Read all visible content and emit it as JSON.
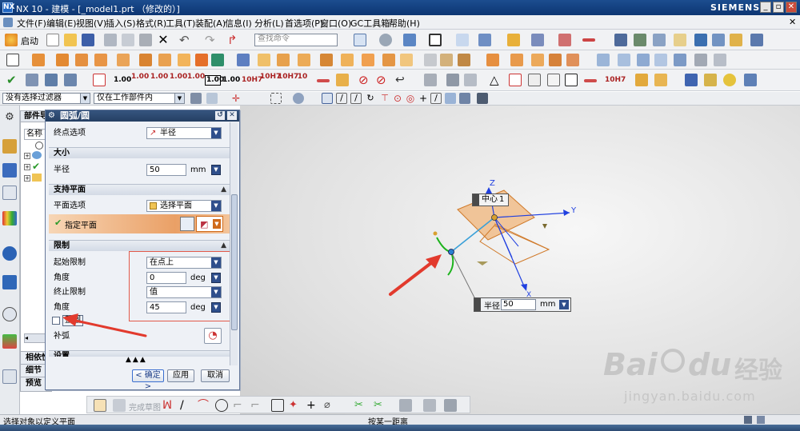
{
  "window": {
    "logo": "NX",
    "title": "NX 10 - 建模 - [_model1.prt （修改的）]",
    "brand": "SIEMENS",
    "min_glyph": "_",
    "restore_glyph": "▫",
    "close_glyph": "✕"
  },
  "menu": {
    "items": [
      "文件(F)",
      "编辑(E)",
      "视图(V)",
      "插入(S)",
      "格式(R)",
      "工具(T)",
      "装配(A)",
      "信息(I)",
      "分析(L)",
      "首选项(P)",
      "窗口(O)",
      "GC工具箱",
      "帮助(H)"
    ],
    "close_glyph": "✕"
  },
  "toolbar": {
    "start_label": "启动",
    "command_search_placeholder": "查找命令",
    "tolerance_labels": [
      "1.00",
      "1.00",
      "1.00",
      "1.00",
      "1.00",
      "1.00",
      "1.00",
      "10H7",
      "10H7",
      "10H7",
      "10",
      "10H7"
    ]
  },
  "selection_bar": {
    "filter_value": "没有选择过滤器",
    "scope_value": "仅在工作部件内"
  },
  "part_navigator": {
    "title": "部件导",
    "column_name": "名称",
    "bottom_sections": [
      "相依性",
      "细节",
      "预览"
    ]
  },
  "dialog": {
    "title": "圆弧/圆",
    "endpoint_option_label": "终点选项",
    "endpoint_option_value": "半径",
    "size_section": "大小",
    "radius_label": "半径",
    "radius_value": "50",
    "radius_unit": "mm",
    "support_plane_section": "支持平面",
    "plane_option_label": "平面选项",
    "plane_option_value": "选择平面",
    "specify_plane_label": "指定平面",
    "limits_section": "限制",
    "start_limit_label": "起始限制",
    "start_limit_value": "在点上",
    "start_angle_label": "角度",
    "start_angle_value": "0",
    "start_angle_unit": "deg",
    "end_limit_label": "终止限制",
    "end_limit_value": "值",
    "end_angle_label": "角度",
    "end_angle_value": "45",
    "end_angle_unit": "deg",
    "full_circle_label": "整圆",
    "complement_arc_label": "补弧",
    "settings_section": "设置",
    "ok_label": "< 确定 >",
    "apply_label": "应用",
    "cancel_label": "取消"
  },
  "viewport": {
    "center_label": "中心",
    "center_index": "1",
    "radius_label": "半径",
    "radius_value": "50",
    "radius_unit": "mm",
    "axis_x": "X",
    "axis_y": "Y",
    "axis_z": "Z",
    "watermark_brand": "Bai",
    "watermark_brand2": "du",
    "watermark_cn": "经验",
    "watermark_url": "jingyan.baidu.com"
  },
  "sketch_toolbar": {
    "finish_sketch_label": "完成草图"
  },
  "status": {
    "left": "选择对象以定义平面",
    "right": "按某一距离"
  },
  "colors": {
    "titlebar": "#0c3572",
    "accent_orange": "#e8a163",
    "annotation_red": "#e23a2d",
    "spin_blue": "#2f4f8c",
    "sheet_orange": "#f0a050"
  }
}
